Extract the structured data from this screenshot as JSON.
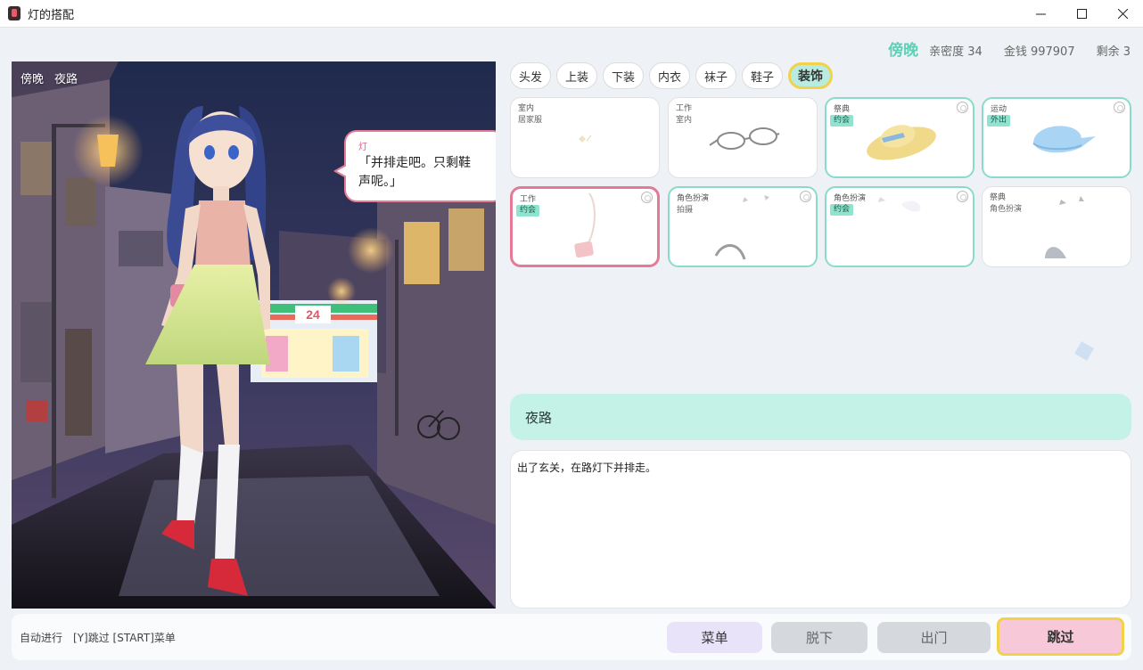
{
  "window": {
    "title": "灯的搭配"
  },
  "status": {
    "time_of_day": "傍晚",
    "affection": "亲密度 34",
    "money": "金钱 997907",
    "remaining": "剩余 3"
  },
  "scene": {
    "time": "傍晚",
    "place": "夜路",
    "store_sign": "24",
    "dialogue": {
      "speaker": "灯",
      "line1": "「并排走吧。只剩鞋",
      "line2": "声呢。」"
    }
  },
  "tabs": [
    {
      "label": "头发",
      "active": false
    },
    {
      "label": "上装",
      "active": false
    },
    {
      "label": "下装",
      "active": false
    },
    {
      "label": "内衣",
      "active": false
    },
    {
      "label": "袜子",
      "active": false
    },
    {
      "label": "鞋子",
      "active": false
    },
    {
      "label": "装饰",
      "active": true
    }
  ],
  "items": [
    {
      "category": "室内",
      "subtitle": "居家服",
      "tag": "",
      "item_icon": "ornament-icon"
    },
    {
      "category": "工作",
      "subtitle": "室内",
      "tag": "",
      "item_icon": "glasses-icon"
    },
    {
      "category": "祭典",
      "subtitle": "",
      "tag": "约会",
      "item_icon": "straw-hat-icon"
    },
    {
      "category": "运动",
      "subtitle": "",
      "tag": "外出",
      "item_icon": "cap-icon"
    },
    {
      "category": "工作",
      "subtitle": "",
      "tag": "约会",
      "item_icon": "shoulder-bag-icon"
    },
    {
      "category": "角色扮演",
      "subtitle": "拍摄",
      "tag": "",
      "item_icon": "hairband-icon"
    },
    {
      "category": "角色扮演",
      "subtitle": "",
      "tag": "约会",
      "item_icon": "ribbon-icon"
    },
    {
      "category": "祭典",
      "subtitle": "角色扮演",
      "tag": "",
      "item_icon": "headpiece-icon"
    }
  ],
  "location": {
    "name": "夜路"
  },
  "description": {
    "text": "出了玄关，在路灯下并排走。"
  },
  "bottom": {
    "auto_label": "自动进行",
    "shortcut_hint": "[Y]跳过 [START]菜单",
    "buttons": {
      "menu": "菜单",
      "undress": "脱下",
      "exit": "出门",
      "skip": "跳过"
    }
  },
  "colors": {
    "accent_teal": "#5fcfb6",
    "tab_active_bg": "#b9ece0",
    "highlight_yellow": "#f2d24b",
    "selected_pink": "#e37b97",
    "location_bg": "#c4f2e6"
  }
}
